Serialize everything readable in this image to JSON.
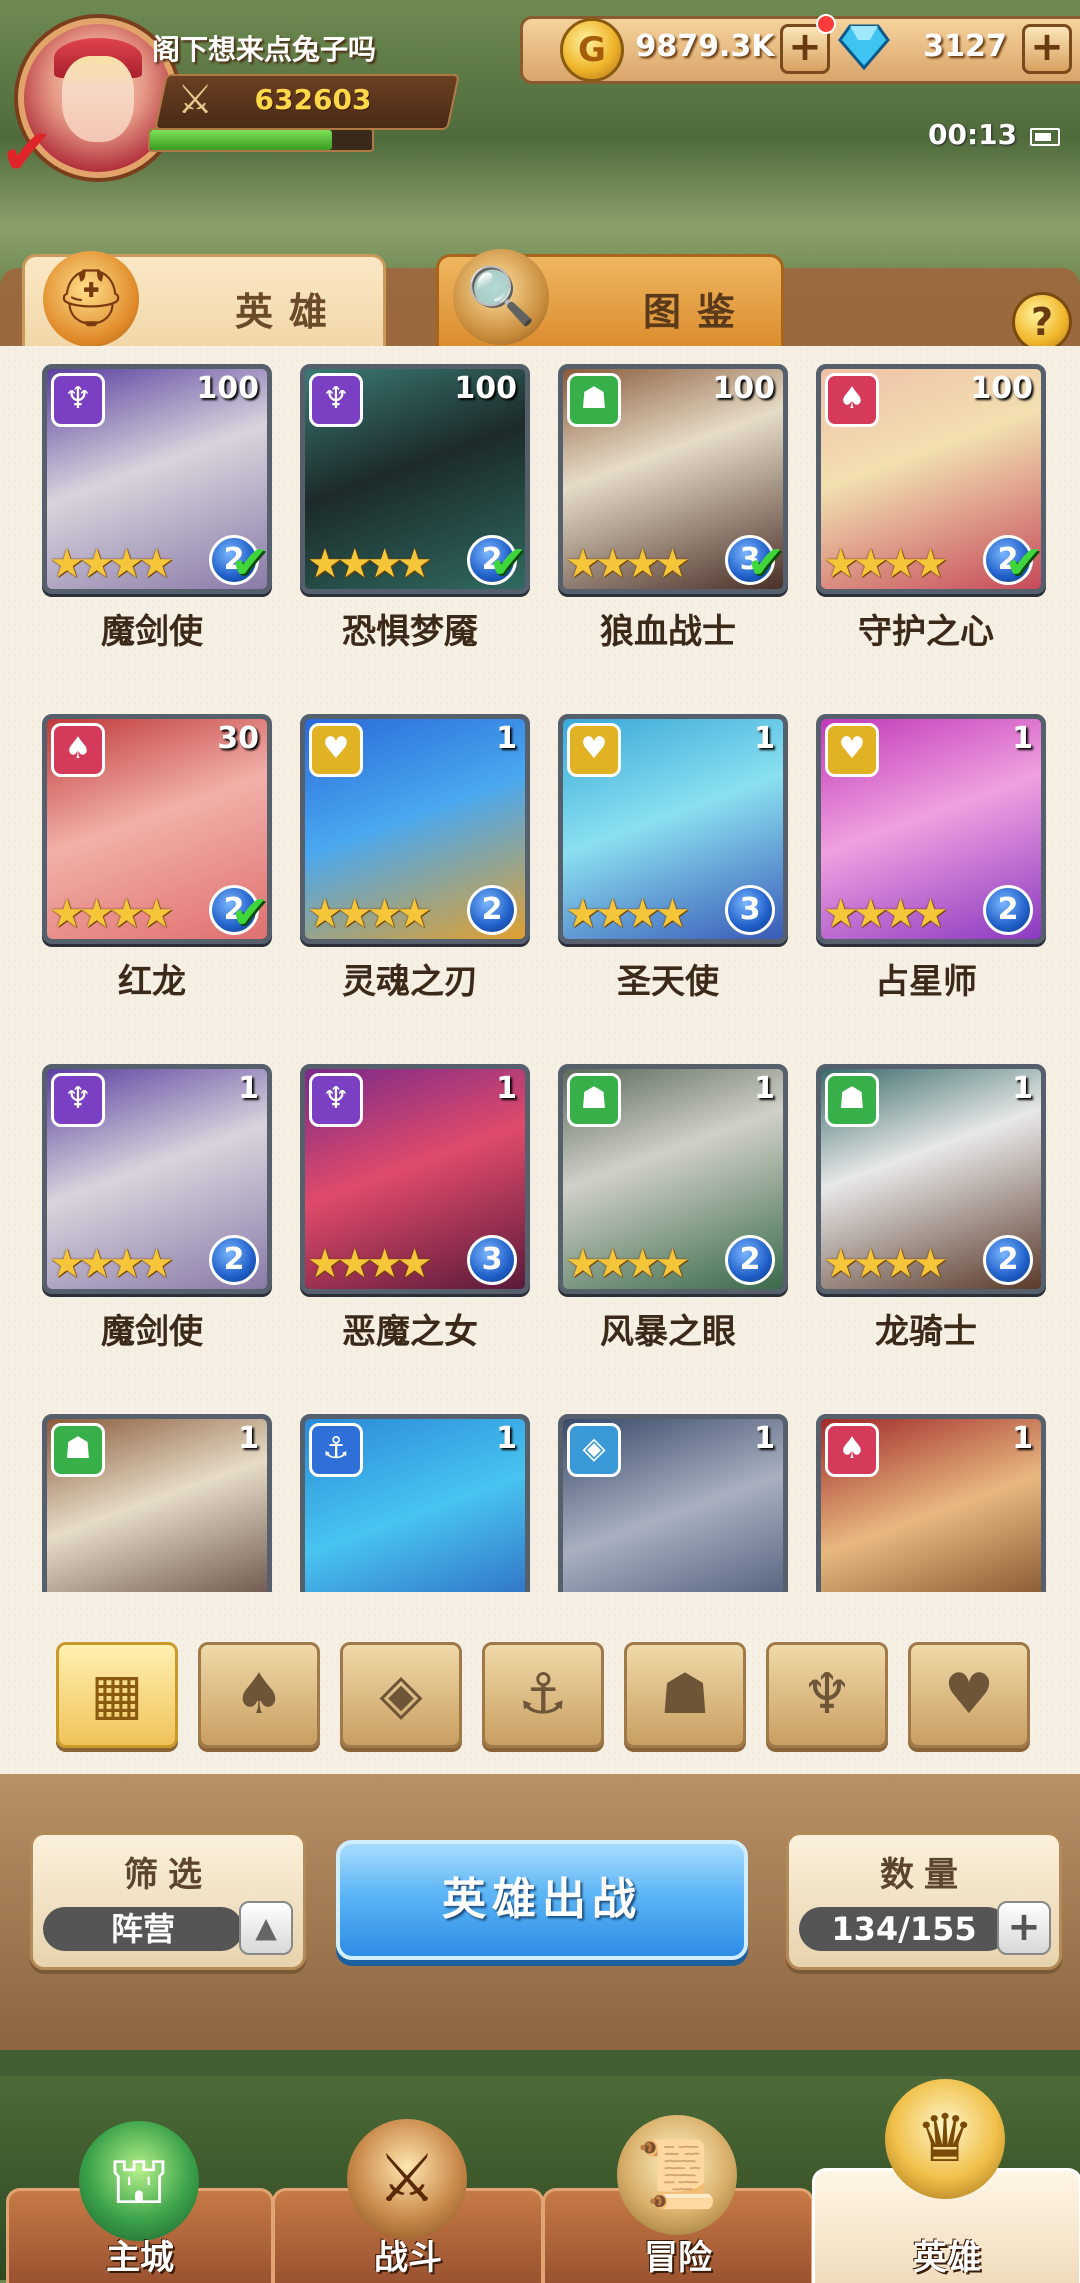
{
  "player": {
    "name": "阁下想来点兔子吗",
    "power": "632603",
    "exp_fraction": 0.82
  },
  "resources": {
    "gold": "9879.3K",
    "gems": "3127",
    "plus": "+"
  },
  "status": {
    "time": "00:13"
  },
  "tabs": [
    {
      "label": "英雄"
    },
    {
      "label": "图鉴"
    }
  ],
  "help": "?",
  "heroes": [
    {
      "name": "魔剑使",
      "level": "100",
      "rank": "2",
      "faction": "dark",
      "checked": true
    },
    {
      "name": "恐惧梦魇",
      "level": "100",
      "rank": "2",
      "faction": "dark",
      "checked": true
    },
    {
      "name": "狼血战士",
      "level": "100",
      "rank": "3",
      "faction": "beast",
      "checked": true
    },
    {
      "name": "守护之心",
      "level": "100",
      "rank": "2",
      "faction": "fire",
      "checked": true
    },
    {
      "name": "红龙",
      "level": "30",
      "rank": "2",
      "faction": "fire",
      "checked": true
    },
    {
      "name": "灵魂之刃",
      "level": "1",
      "rank": "2",
      "faction": "light",
      "checked": false
    },
    {
      "name": "圣天使",
      "level": "1",
      "rank": "3",
      "faction": "light",
      "checked": false
    },
    {
      "name": "占星师",
      "level": "1",
      "rank": "2",
      "faction": "light",
      "checked": false
    },
    {
      "name": "魔剑使",
      "level": "1",
      "rank": "2",
      "faction": "dark",
      "checked": false
    },
    {
      "name": "恶魔之女",
      "level": "1",
      "rank": "3",
      "faction": "dark",
      "checked": false
    },
    {
      "name": "风暴之眼",
      "level": "1",
      "rank": "2",
      "faction": "beast",
      "checked": false
    },
    {
      "name": "龙骑士",
      "level": "1",
      "rank": "2",
      "faction": "beast",
      "checked": false
    },
    {
      "name": "",
      "level": "1",
      "rank": "",
      "faction": "beast",
      "checked": false
    },
    {
      "name": "",
      "level": "1",
      "rank": "",
      "faction": "anchor",
      "checked": false
    },
    {
      "name": "",
      "level": "1",
      "rank": "",
      "faction": "diamond",
      "checked": false
    },
    {
      "name": "",
      "level": "1",
      "rank": "",
      "faction": "fire",
      "checked": false
    }
  ],
  "faction_colors": {
    "dark": "#7b3fc4",
    "beast": "#37b04a",
    "fire": "#d63a5a",
    "light": "#e0b224",
    "anchor": "#2f6fd8",
    "diamond": "#3a9ad8"
  },
  "filters": [
    {
      "icon": "grid-icon",
      "glyph": "▦",
      "active": true
    },
    {
      "icon": "fire-faction-icon",
      "glyph": "♠",
      "active": false
    },
    {
      "icon": "diamond-faction-icon",
      "glyph": "◈",
      "active": false
    },
    {
      "icon": "anchor-faction-icon",
      "glyph": "⚓",
      "active": false
    },
    {
      "icon": "beast-faction-icon",
      "glyph": "☗",
      "active": false
    },
    {
      "icon": "dark-faction-icon",
      "glyph": "♆",
      "active": false
    },
    {
      "icon": "light-faction-icon",
      "glyph": "♥",
      "active": false
    }
  ],
  "filter_panel": {
    "title": "筛选",
    "value": "阵营",
    "arrow": "▲"
  },
  "deploy": {
    "label": "英雄出战"
  },
  "count_panel": {
    "title": "数量",
    "value": "134/155",
    "plus": "+"
  },
  "nav": [
    {
      "label": "主城",
      "active": false
    },
    {
      "label": "战斗",
      "active": false
    },
    {
      "label": "冒险",
      "active": false
    },
    {
      "label": "英雄",
      "active": true
    }
  ]
}
